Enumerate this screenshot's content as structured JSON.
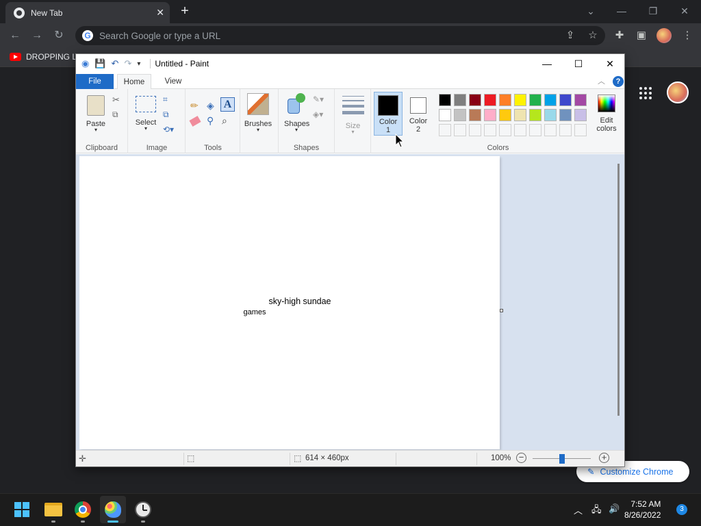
{
  "chrome": {
    "tab_title": "New Tab",
    "omnibox_placeholder": "Search Google or type a URL",
    "bookmark_label": "DROPPING LE",
    "customize_label": "Customize Chrome"
  },
  "paint": {
    "window_title": "Untitled - Paint",
    "tabs": {
      "file": "File",
      "home": "Home",
      "view": "View"
    },
    "groups": {
      "clipboard": "Clipboard",
      "image": "Image",
      "tools": "Tools",
      "shapes": "Shapes",
      "colors": "Colors"
    },
    "buttons": {
      "paste": "Paste",
      "select": "Select",
      "brushes": "Brushes",
      "shapes": "Shapes",
      "size": "Size",
      "color1_line1": "Color",
      "color1_line2": "1",
      "color2_line1": "Color",
      "color2_line2": "2",
      "edit_colors_line1": "Edit",
      "edit_colors_line2": "colors"
    },
    "palette_row1": [
      "#000000",
      "#7f7f7f",
      "#880015",
      "#ed1c24",
      "#ff7f27",
      "#fff200",
      "#22b14c",
      "#00a2e8",
      "#3f48cc",
      "#a349a4"
    ],
    "palette_row2": [
      "#ffffff",
      "#c3c3c3",
      "#b97a57",
      "#ffaec9",
      "#ffc90e",
      "#efe4b0",
      "#b5e61d",
      "#99d9ea",
      "#7092be",
      "#c8bfe7"
    ],
    "color1": "#000000",
    "color2": "#ffffff",
    "canvas_text_line1": "sky-high sundae",
    "canvas_text_line2": "games",
    "status": {
      "dimensions": "614 × 460px",
      "zoom": "100%",
      "zoom_level": 100
    }
  },
  "taskbar": {
    "time": "7:52 AM",
    "date": "8/26/2022",
    "notifications": "3"
  }
}
